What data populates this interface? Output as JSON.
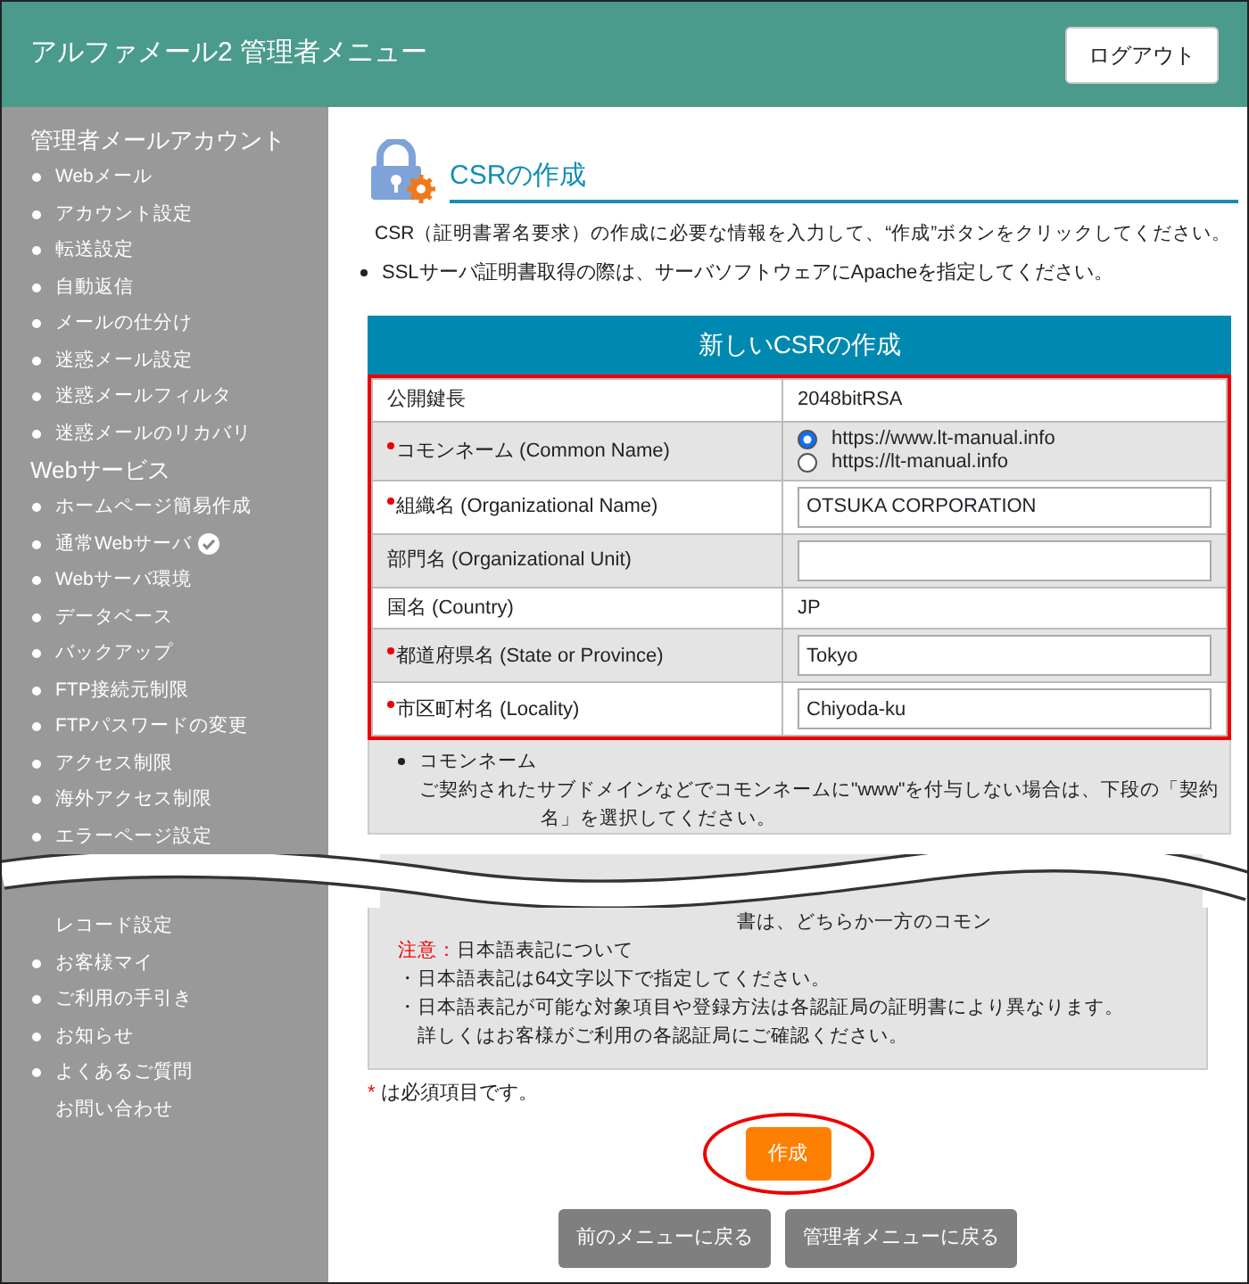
{
  "header": {
    "title": "アルファメール2 管理者メニュー",
    "logout_button": "ログアウト"
  },
  "sidebar": {
    "sections": [
      {
        "title": "管理者メールアカウント",
        "items": [
          {
            "label": "Webメール",
            "kind": "bullet",
            "current": false
          },
          {
            "label": "アカウント設定",
            "kind": "bullet",
            "current": false
          },
          {
            "label": "転送設定",
            "kind": "bullet",
            "current": false
          },
          {
            "label": "自動返信",
            "kind": "bullet",
            "current": false
          },
          {
            "label": "メールの仕分け",
            "kind": "bullet",
            "current": false
          },
          {
            "label": "迷惑メール設定",
            "kind": "bullet",
            "current": false
          },
          {
            "label": "迷惑メールフィルタ",
            "kind": "bullet",
            "current": false
          },
          {
            "label": "迷惑メールのリカバリ",
            "kind": "bullet",
            "current": false
          }
        ]
      },
      {
        "title": "Webサービス",
        "items": [
          {
            "label": "ホームページ簡易作成",
            "kind": "bullet",
            "current": false
          },
          {
            "label": "通常Webサーバ",
            "kind": "bullet",
            "current": true
          },
          {
            "label": "Webサーバ環境",
            "kind": "bullet",
            "current": false
          },
          {
            "label": "データベース",
            "kind": "bullet",
            "current": false
          },
          {
            "label": "バックアップ",
            "kind": "bullet",
            "current": false
          },
          {
            "label": "FTP接続元制限",
            "kind": "bullet",
            "current": false
          },
          {
            "label": "FTPパスワードの変更",
            "kind": "bullet",
            "current": false
          },
          {
            "label": "アクセス制限",
            "kind": "bullet",
            "current": false
          },
          {
            "label": "海外アクセス制限",
            "kind": "bullet",
            "current": false
          },
          {
            "label": "エラーページ設定",
            "kind": "bullet",
            "current": false
          }
        ]
      }
    ],
    "items_after_break": [
      {
        "label": "レコード設定",
        "kind": "plain",
        "current": false
      },
      {
        "label": "お客様マイ",
        "kind": "bullet",
        "current": false
      },
      {
        "label": "ご利用の手引き",
        "kind": "bullet",
        "current": false
      },
      {
        "label": "お知らせ",
        "kind": "bullet",
        "current": false
      },
      {
        "label": "よくあるご質問",
        "kind": "bullet",
        "current": false
      },
      {
        "label": "お問い合わせ",
        "kind": "plain",
        "current": false
      }
    ]
  },
  "main": {
    "page_title": "CSRの作成",
    "intro": "CSR（証明書署名要求）の作成に必要な情報を入力して、“作成”ボタンをクリックしてください。",
    "bullets": [
      "SSLサーバ証明書取得の際は、サーバソフトウェアにApacheを指定してください。"
    ],
    "form": {
      "title": "新しいCSRの作成",
      "highlighted": true,
      "rows": [
        {
          "label": "公開鍵長",
          "required": false,
          "kind": "text",
          "value": "2048bitRSA"
        },
        {
          "label": "コモンネーム (Common Name)",
          "required": true,
          "kind": "radio",
          "options": [
            {
              "label": "https://www.lt-manual.info",
              "selected": true
            },
            {
              "label": "https://lt-manual.info",
              "selected": false
            }
          ]
        },
        {
          "label": "組織名 (Organizational Name)",
          "required": true,
          "kind": "input",
          "value": "OTSUKA CORPORATION"
        },
        {
          "label": "部門名 (Organizational Unit)",
          "required": false,
          "kind": "input"
        },
        {
          "label": "国名 (Country)",
          "required": false,
          "kind": "text",
          "value": "JP"
        },
        {
          "label": "都道府県名 (State or Province)",
          "required": true,
          "kind": "input",
          "value": "Tokyo"
        },
        {
          "label": "市区町村名 (Locality)",
          "required": true,
          "kind": "input",
          "value": "Chiyoda-ku"
        }
      ]
    },
    "notes_before_break": {
      "heading": "コモンネーム",
      "lines": [
        "ご契約されたサブドメインなどでコモンネームに\"www\"を付与しない場合は、下段の「契約",
        "名」を選択してください。"
      ]
    },
    "notes_after_break": {
      "continued_lines": [
        "書は、どちらか一方のコモン"
      ],
      "caution_label": "注意：",
      "caution_text": "日本語表記について",
      "lines": [
        "・日本語表記は64文字以下で指定してください。",
        "・日本語表記が可能な対象項目や登録方法は各認証局の証明書により異なります。",
        "詳しくはお客様がご利用の各認証局にご確認ください。"
      ]
    },
    "required_note": {
      "mark": "*",
      "text": "は必須項目です。"
    },
    "submit_button": {
      "label": "作成",
      "highlighted": true
    },
    "nav_buttons": [
      "前のメニューに戻る",
      "管理者メニューに戻る"
    ]
  }
}
